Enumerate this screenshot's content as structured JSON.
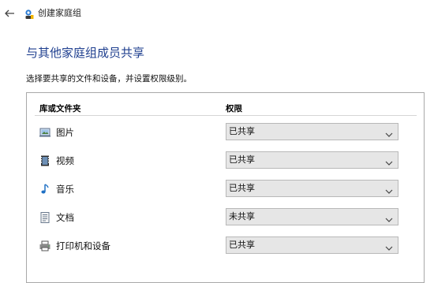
{
  "window": {
    "title": "创建家庭组",
    "back_icon": "back-arrow-icon",
    "app_icon": "homegroup-icon"
  },
  "page": {
    "heading": "与其他家庭组成员共享",
    "description": "选择要共享的文件和设备，并设置权限级别。"
  },
  "table": {
    "col_library": "库或文件夹",
    "col_permission": "权限",
    "rows": [
      {
        "icon": "pictures-icon",
        "label": "图片",
        "permission": "已共享"
      },
      {
        "icon": "videos-icon",
        "label": "视频",
        "permission": "已共享"
      },
      {
        "icon": "music-icon",
        "label": "音乐",
        "permission": "已共享"
      },
      {
        "icon": "documents-icon",
        "label": "文档",
        "permission": "未共享"
      },
      {
        "icon": "printer-icon",
        "label": "打印机和设备",
        "permission": "已共享"
      }
    ]
  },
  "colors": {
    "heading": "#1f3f8f",
    "select_bg": "#e6e6e6",
    "panel_border": "#a9a9a9"
  }
}
